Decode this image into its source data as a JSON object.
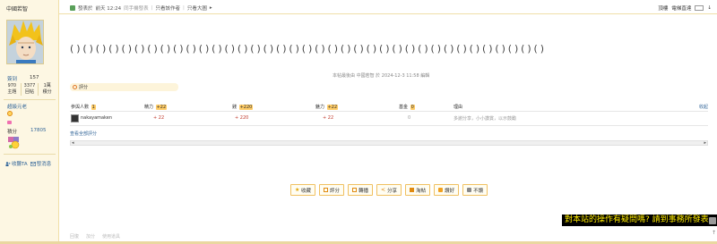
{
  "sidebar": {
    "username": "中國若智",
    "sign_label": "簽到",
    "sign_value": "157",
    "stats": [
      {
        "value": "970",
        "label": "主題"
      },
      {
        "value": "3377",
        "label": "回帖"
      },
      {
        "value": "1萬",
        "label": "積分"
      }
    ],
    "rank": "超級元老",
    "points_label": "積分",
    "points_value": "17805",
    "links": [
      {
        "icon": "users-icon",
        "label": "收聽TA"
      },
      {
        "icon": "message-icon",
        "label": "發消息"
      }
    ]
  },
  "topbar": {
    "post_prefix": "發表於",
    "post_time": "前天 12:24",
    "post_source": "同手機發表",
    "filter1": "只看該作者",
    "filter2": "只看大圖",
    "right1": "頂樓",
    "right2": "電梯直達",
    "jump_icon": "down-arrow-icon"
  },
  "content": {
    "body_text": "( ) ( ) ( ) ( ) ( ) ( ) ( ) ( ) ( ) ( ) ( ) ( ) ( ) ( ) ( ) ( ) ( ) ( ) ( ) ( ) ( ) ( ) ( ) ( ) ( ) ( ) ( ) ( ) ( ) ( ) ( ) ( ) ( ) ( ) ( ) ( ) ( )",
    "edit_note": "本帖最後由 中國若智 於 2024-12-3 11:58 編輯"
  },
  "rating": {
    "label": "評分",
    "headers": {
      "participants": "參與人數",
      "participants_count": "1",
      "energy": "精力",
      "energy_total": "+22",
      "money": "錢",
      "money_total": "+220",
      "charm": "魅力",
      "charm_total": "+22",
      "fund": "基金",
      "fund_total": "0",
      "reason": "理由",
      "collapse": "收起"
    },
    "rows": [
      {
        "user": "nakayamaken",
        "energy": "+ 22",
        "money": "+ 220",
        "charm": "+ 22",
        "fund": "0",
        "reason": "多謝分享，小小讚賞，以示鼓勵"
      }
    ],
    "view_all": "查看全部評分"
  },
  "actions": [
    {
      "icon": "star-icon",
      "label": "收藏"
    },
    {
      "icon": "rate-icon",
      "label": "評分"
    },
    {
      "icon": "forward-icon",
      "label": "轉播"
    },
    {
      "icon": "share-icon",
      "label": "分享"
    },
    {
      "icon": "tao-icon",
      "label": "淘帖"
    },
    {
      "icon": "thumbs-up-icon",
      "label": "讚好"
    },
    {
      "icon": "thumbs-down-icon",
      "label": "不讚"
    }
  ],
  "bottom_links": [
    "回復",
    "加分",
    "使用道具"
  ],
  "notice": "對本站的操作有疑問嗎? 請到事務所發表",
  "colors": {
    "sidebar_bg": "#fdf7e3",
    "accent": "#336699",
    "notice_bg": "#000000",
    "notice_text": "#ffeb00"
  }
}
